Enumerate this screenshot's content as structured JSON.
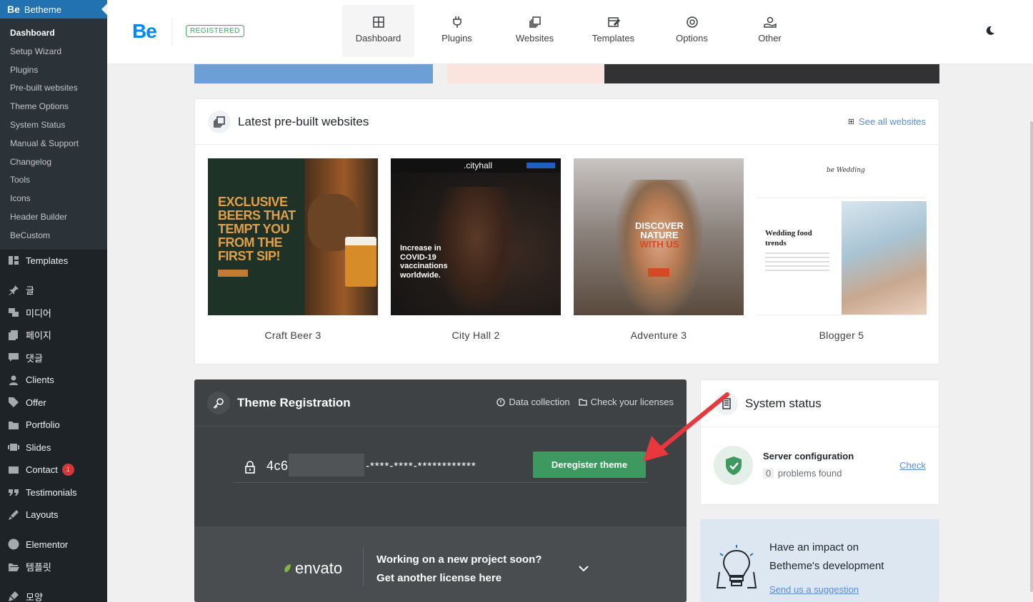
{
  "wp_sidebar": {
    "brand_icon": "Be",
    "brand_label": "Betheme",
    "submenu": [
      "Dashboard",
      "Setup Wizard",
      "Plugins",
      "Pre-built websites",
      "Theme Options",
      "System Status",
      "Manual & Support",
      "Changelog",
      "Tools",
      "Icons",
      "Header Builder",
      "BeCustom"
    ],
    "menu": [
      {
        "label": "Templates",
        "icon": "templates-icon"
      },
      {
        "label": "글",
        "icon": "pin-icon"
      },
      {
        "label": "미디어",
        "icon": "media-icon"
      },
      {
        "label": "페이지",
        "icon": "page-icon"
      },
      {
        "label": "댓글",
        "icon": "comment-icon"
      },
      {
        "label": "Clients",
        "icon": "clients-icon"
      },
      {
        "label": "Offer",
        "icon": "tag-icon"
      },
      {
        "label": "Portfolio",
        "icon": "folder-icon"
      },
      {
        "label": "Slides",
        "icon": "slides-icon"
      },
      {
        "label": "Contact",
        "icon": "mail-icon",
        "badge": "1"
      },
      {
        "label": "Testimonials",
        "icon": "quote-icon"
      },
      {
        "label": "Layouts",
        "icon": "brush-icon"
      },
      {
        "label": "Elementor",
        "icon": "elementor-icon"
      },
      {
        "label": "템플릿",
        "icon": "folder-open-icon"
      },
      {
        "label": "모양",
        "icon": "appearance-icon"
      }
    ]
  },
  "header": {
    "logo": "Be",
    "badge": "REGISTERED",
    "tabs": [
      "Dashboard",
      "Plugins",
      "Websites",
      "Templates",
      "Options",
      "Other"
    ],
    "active_tab": "Dashboard"
  },
  "prebuilt": {
    "title": "Latest pre-built websites",
    "see_all": "See all websites",
    "sites": [
      {
        "name": "Craft Beer 3",
        "headline": "EXCLUSIVE BEERS THAT TEMPT YOU FROM THE FIRST SIP!"
      },
      {
        "name": "City Hall 2",
        "logo": ".cityhall",
        "headline": "Increase in COVID-19 vaccinations worldwide."
      },
      {
        "name": "Adventure 3",
        "headline_a": "DISCOVER NATURE",
        "headline_b": "WITH US"
      },
      {
        "name": "Blogger 5",
        "logo": "be Wedding",
        "headline": "Wedding food trends"
      }
    ]
  },
  "registration": {
    "title": "Theme Registration",
    "data_collection": "Data collection",
    "check_licenses": "Check your licenses",
    "key_prefix": "4c6",
    "key_masked": "-****-****-************",
    "deregister": "Deregister theme",
    "envato_logo": "envato",
    "envato_line1": "Working on a new project soon?",
    "envato_line2": "Get another license here"
  },
  "system_status": {
    "title": "System status",
    "server_title": "Server configuration",
    "problems_count": "0",
    "problems_text": "problems found",
    "check": "Check"
  },
  "impact": {
    "line1": "Have an impact on",
    "line2": "Betheme's development",
    "link": "Send us a suggestion"
  },
  "colors": {
    "accent": "#0089f7",
    "registered": "#3dab5f",
    "deregister_button": "#3d9960",
    "link": "#5a8ed4",
    "annotation_arrow": "#e8383d"
  }
}
